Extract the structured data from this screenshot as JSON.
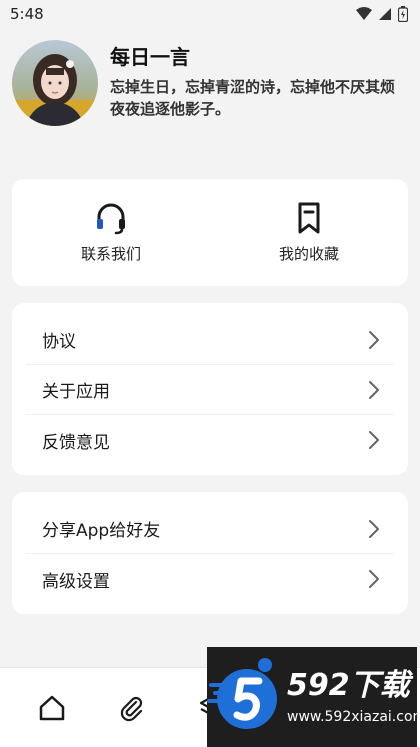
{
  "status_bar": {
    "time": "5:48",
    "icons": [
      "wifi-icon",
      "signal-icon",
      "battery-icon"
    ]
  },
  "profile": {
    "name": "每日一言",
    "quote": "忘掉生日，忘掉青涩的诗，忘掉他不厌其烦夜夜追逐他影子。"
  },
  "actions": [
    {
      "label": "联系我们",
      "icon": "headset-icon"
    },
    {
      "label": "我的收藏",
      "icon": "bookmark-icon"
    }
  ],
  "menu_group_1": [
    {
      "label": "协议"
    },
    {
      "label": "关于应用"
    },
    {
      "label": "反馈意见"
    }
  ],
  "menu_group_2": [
    {
      "label": "分享App给好友"
    },
    {
      "label": "高级设置"
    }
  ],
  "bottom_nav": {
    "icons": [
      "home-icon",
      "paperclip-icon",
      "layers-icon"
    ]
  },
  "watermark": {
    "brand": "592下载",
    "url": "www.592xiazai.com"
  },
  "colors": {
    "accent": "#1f57c8",
    "card": "#ffffff",
    "background": "#f3f3f3"
  }
}
